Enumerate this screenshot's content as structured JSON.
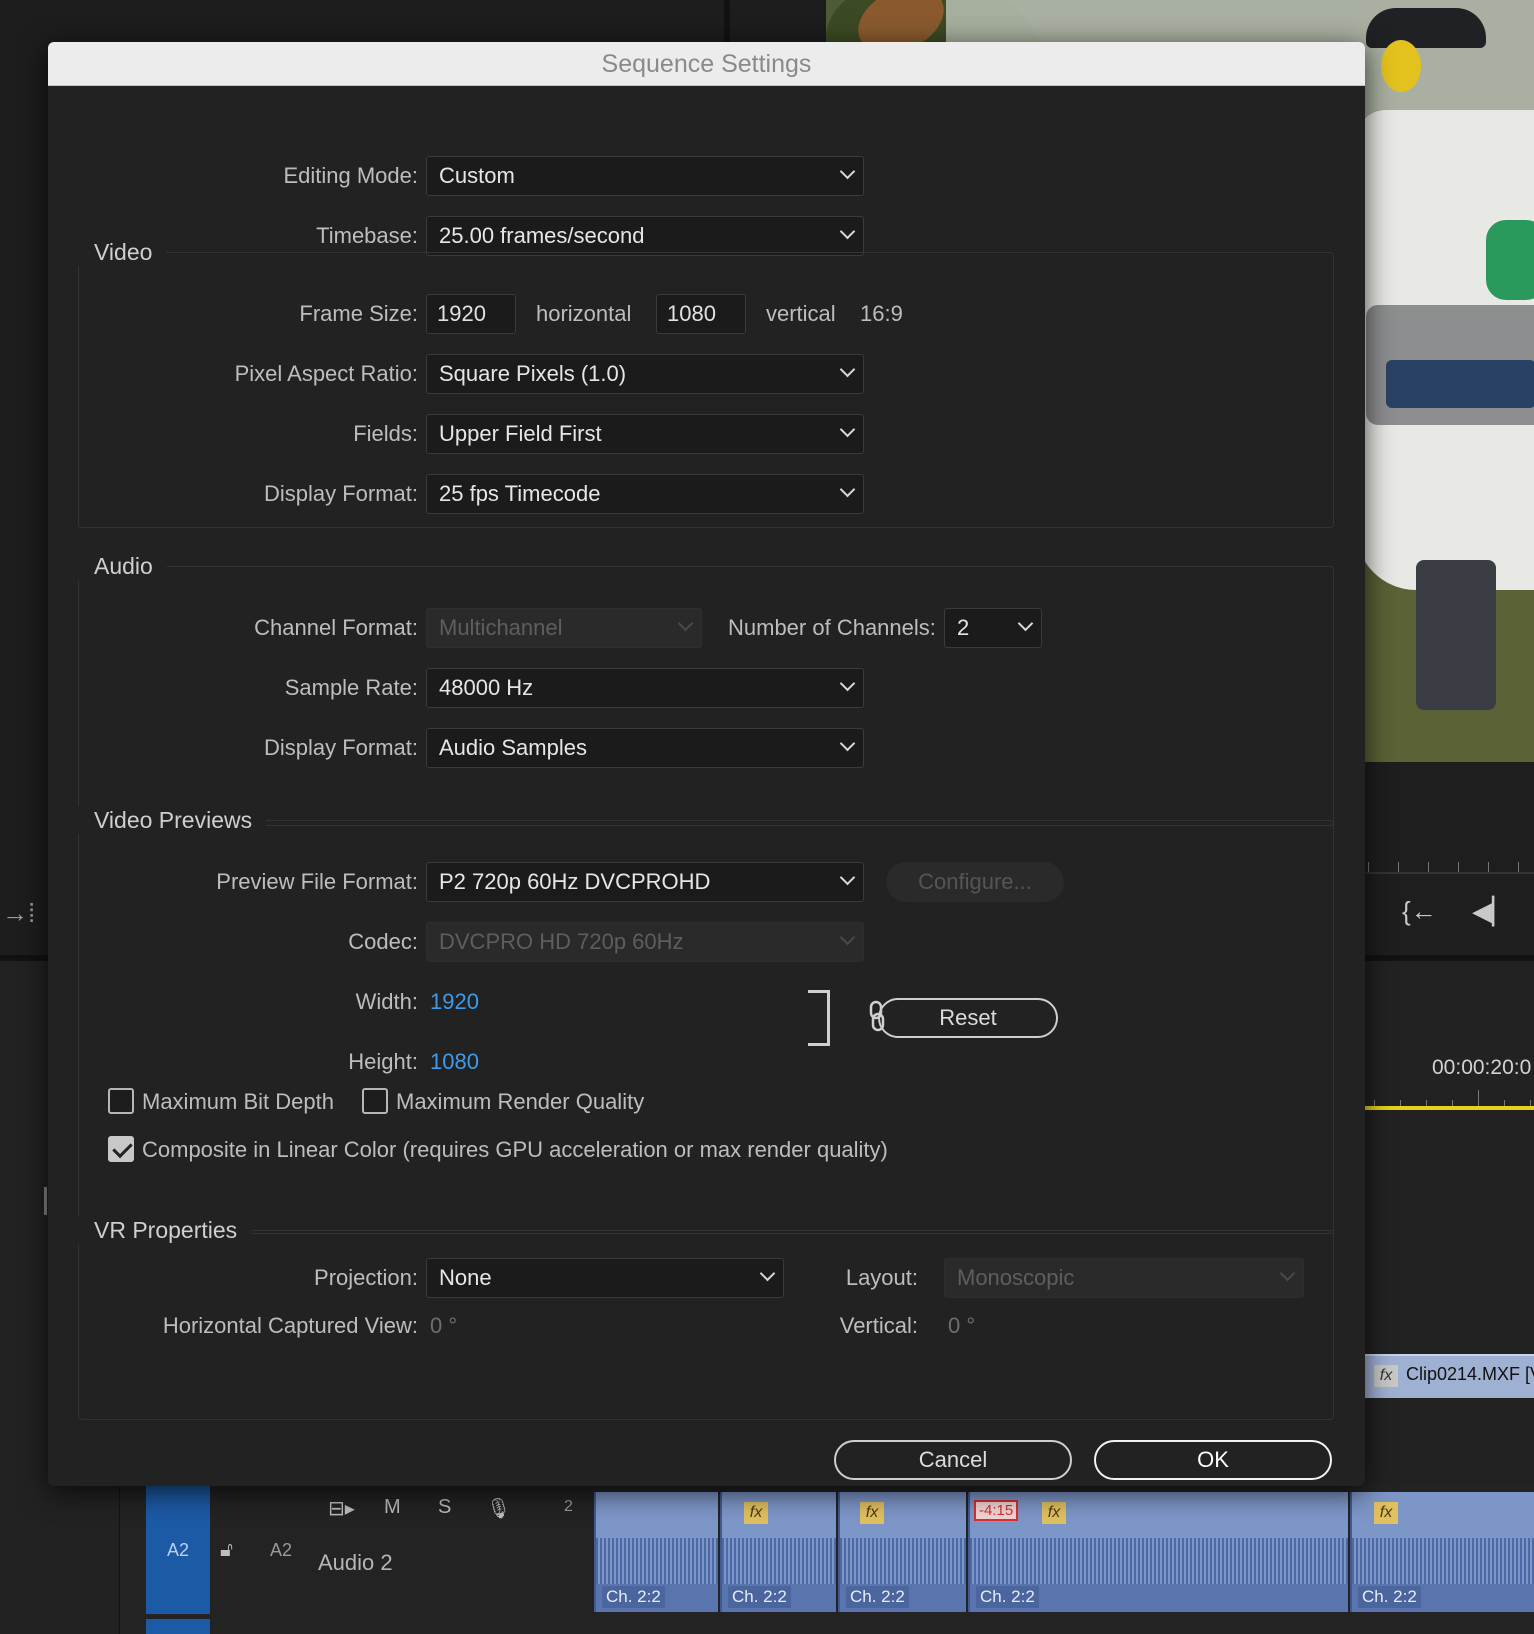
{
  "dialog": {
    "title": "Sequence Settings",
    "editing_mode": {
      "label": "Editing Mode:",
      "value": "Custom"
    },
    "timebase": {
      "label": "Timebase:",
      "value": "25.00  frames/second"
    },
    "video": {
      "title": "Video",
      "frame_size_label": "Frame Size:",
      "width": "1920",
      "horizontal_label": "horizontal",
      "height": "1080",
      "vertical_label": "vertical",
      "aspect": "16:9",
      "pixel_aspect": {
        "label": "Pixel Aspect Ratio:",
        "value": "Square Pixels (1.0)"
      },
      "fields": {
        "label": "Fields:",
        "value": "Upper Field First"
      },
      "display_format": {
        "label": "Display Format:",
        "value": "25 fps Timecode"
      }
    },
    "audio": {
      "title": "Audio",
      "channel_format": {
        "label": "Channel Format:",
        "value": "Multichannel"
      },
      "num_channels": {
        "label": "Number of Channels:",
        "value": "2"
      },
      "sample_rate": {
        "label": "Sample Rate:",
        "value": "48000 Hz"
      },
      "display_format": {
        "label": "Display Format:",
        "value": "Audio Samples"
      }
    },
    "video_previews": {
      "title": "Video Previews",
      "preview_file_format": {
        "label": "Preview File Format:",
        "value": "P2 720p 60Hz DVCPROHD"
      },
      "configure_label": "Configure...",
      "codec": {
        "label": "Codec:",
        "value": "DVCPRO HD 720p 60Hz"
      },
      "width": {
        "label": "Width:",
        "value": "1920"
      },
      "height": {
        "label": "Height:",
        "value": "1080"
      },
      "reset_label": "Reset",
      "max_bit_depth": {
        "label": "Maximum Bit Depth",
        "checked": false
      },
      "max_render_quality": {
        "label": "Maximum Render Quality",
        "checked": false
      },
      "composite_linear": {
        "label": "Composite in Linear Color (requires GPU acceleration or max render quality)",
        "checked": true
      }
    },
    "vr_properties": {
      "title": "VR Properties",
      "projection": {
        "label": "Projection:",
        "value": "None"
      },
      "layout": {
        "label": "Layout:",
        "value": "Monoscopic"
      },
      "horizontal_captured_view": {
        "label": "Horizontal Captured View:",
        "value": "0 °"
      },
      "vertical": {
        "label": "Vertical:",
        "value": "0 °"
      }
    },
    "buttons": {
      "cancel": "Cancel",
      "ok": "OK"
    }
  },
  "background": {
    "timecode": "00:00:20:0",
    "clip_name": "Clip0214.MXF [V",
    "track": {
      "header": "A2",
      "target": "A2",
      "name": "Audio 2",
      "channel_num": "2",
      "mute": "M",
      "solo": "S",
      "clip_channel_label": "Ch. 2:2",
      "clip_timecode": "-4:15",
      "fx_label": "fx"
    }
  }
}
